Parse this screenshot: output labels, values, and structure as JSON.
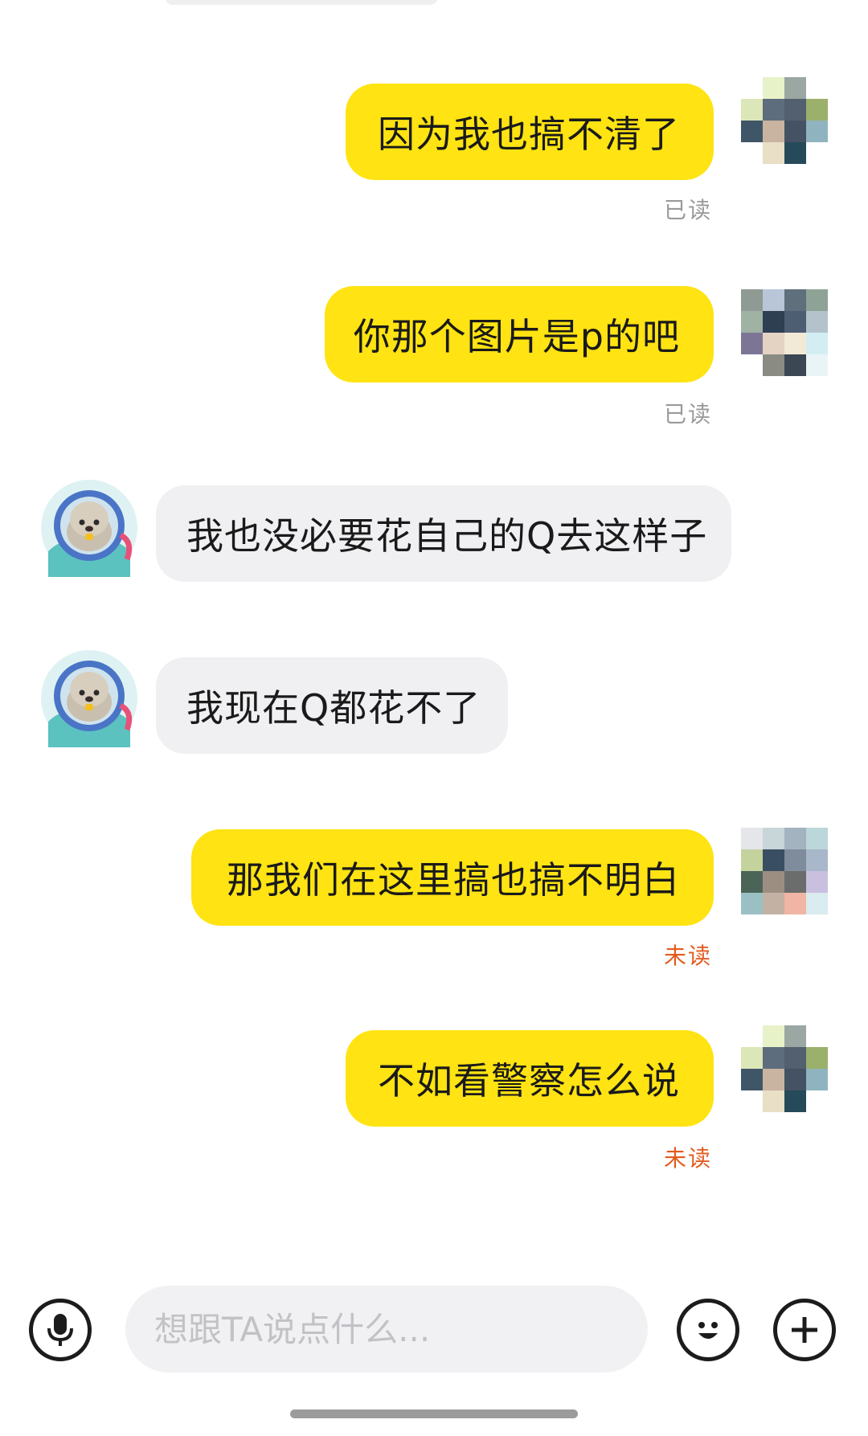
{
  "messages": [
    {
      "side": "me",
      "text": "因为我也搞不清了",
      "status": "已读",
      "status_type": "read"
    },
    {
      "side": "me",
      "text": "你那个图片是p的吧",
      "status": "已读",
      "status_type": "read"
    },
    {
      "side": "them",
      "text": "我也没必要花自己的Q去这样子"
    },
    {
      "side": "them",
      "text": "我现在Q都花不了"
    },
    {
      "side": "me",
      "text": "那我们在这里搞也搞不明白",
      "status": "未读",
      "status_type": "unread"
    },
    {
      "side": "me",
      "text": "不如看警察怎么说",
      "status": "未读",
      "status_type": "unread"
    }
  ],
  "composer": {
    "placeholder": "想跟TA说点什么..."
  },
  "icons": {
    "voice": "microphone-icon",
    "emoji": "smiley-icon",
    "more": "plus-icon"
  },
  "colors": {
    "my_bubble": "#ffe312",
    "their_bubble": "#f0f0f2",
    "read_status": "#9a9a9a",
    "unread_status": "#e35b1e"
  }
}
